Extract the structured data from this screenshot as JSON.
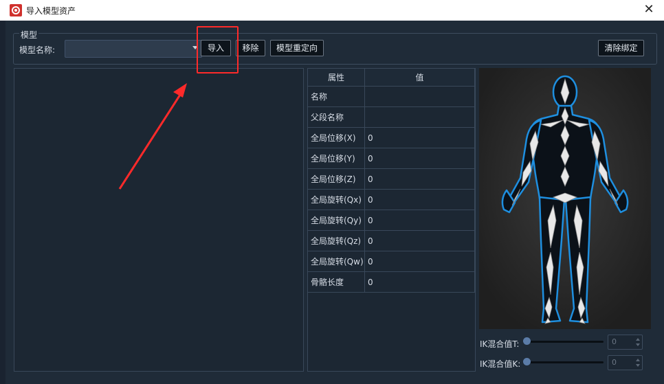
{
  "window": {
    "title": "导入模型资产",
    "close_glyph": "✕"
  },
  "model_group": {
    "title": "模型",
    "name_label": "模型名称:",
    "name_value": "",
    "buttons": {
      "import": "导入",
      "remove": "移除",
      "retarget": "模型重定向",
      "clear_binding": "清除绑定"
    }
  },
  "properties": {
    "headers": [
      "属性",
      "值"
    ],
    "rows": [
      {
        "key": "名称",
        "value": ""
      },
      {
        "key": "父段名称",
        "value": ""
      },
      {
        "key": "全局位移(X)",
        "value": "0"
      },
      {
        "key": "全局位移(Y)",
        "value": "0"
      },
      {
        "key": "全局位移(Z)",
        "value": "0"
      },
      {
        "key": "全局旋转(Qx)",
        "value": "0"
      },
      {
        "key": "全局旋转(Qy)",
        "value": "0"
      },
      {
        "key": "全局旋转(Qz)",
        "value": "0"
      },
      {
        "key": "全局旋转(Qw)",
        "value": "0"
      },
      {
        "key": "骨骼长度",
        "value": "0"
      }
    ]
  },
  "ik": {
    "t_label": "IK混合值T:",
    "t_value": "0",
    "t_level": 0,
    "k_label": "IK混合值K:",
    "k_value": "0",
    "k_level": 0
  },
  "colors": {
    "annotation": "#ff2a2a",
    "body_outline": "#1e8fe0",
    "bone": "#e8e8e8"
  }
}
